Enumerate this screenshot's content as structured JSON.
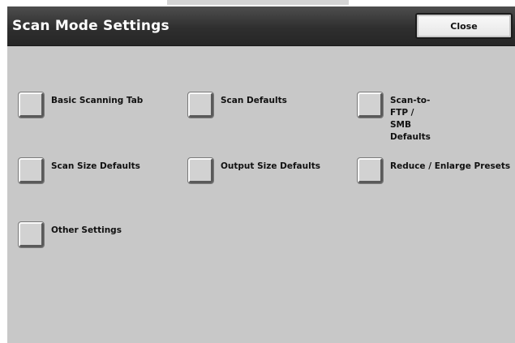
{
  "header": {
    "title": "Scan Mode Settings",
    "close_label": "Close"
  },
  "options": [
    {
      "label": "Basic Scanning Tab"
    },
    {
      "label": "Scan Defaults"
    },
    {
      "label": "Scan-to-FTP / SMB\nDefaults"
    },
    {
      "label": "Scan Size Defaults"
    },
    {
      "label": "Output Size Defaults"
    },
    {
      "label": "Reduce / Enlarge Presets"
    },
    {
      "label": "Other Settings"
    }
  ],
  "colors": {
    "title_bar": "#2f2f2f",
    "background": "#c8c8c8",
    "button_face": "#d2d2d2"
  }
}
